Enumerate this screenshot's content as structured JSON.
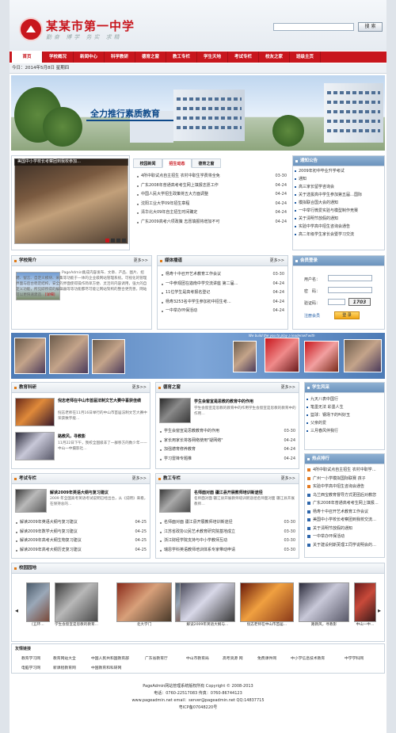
{
  "header": {
    "school_name": "某某市第一中学",
    "motto": "勤奋 博学 务实 求精",
    "search_placeholder": "",
    "search_label": "搜 索"
  },
  "nav": [
    "首页",
    "学校概况",
    "新闻中心",
    "科学教研",
    "德育之窗",
    "教工专栏",
    "学生天地",
    "考试专栏",
    "校友之家",
    "班级主页"
  ],
  "date_text": "今日：2014年5月8日 星期四",
  "banner": {
    "slogan": "全力推行素质教育"
  },
  "focus": {
    "caption": "美国中小学校长考察团到我校参加…"
  },
  "news_tabs": [
    "校园新闻",
    "招生动态",
    "德育之窗"
  ],
  "news": [
    {
      "title": "4所中职试点自主招生 农村中职生学费将全免",
      "date": "03-30"
    },
    {
      "title": "广东2008年普通高考考生网上填报志愿工作",
      "date": "04-24"
    },
    {
      "title": "中国人民大学招生政策将五大方面调整",
      "date": "04-24"
    },
    {
      "title": "沈阳工业大学09年招生章程",
      "date": "04-24"
    },
    {
      "title": "清华北大09年自主招生时间确定",
      "date": "04-24"
    },
    {
      "title": "广东2009高考六项政策 志愿填报将增加不可",
      "date": "04-24"
    }
  ],
  "notice": {
    "title": "通知公告",
    "items": [
      "2009年初中毕业升学考试",
      "通知",
      "高三家长留学咨询会",
      "关于选拔高中学生参加第五届…国际",
      "模拟联合国大会的通知",
      "一中举行微爱实验与模型制作竞赛",
      "关于清明节放假的通知",
      "实验中学高中招生咨询会通告",
      "高二年级学生家长会暨学习交流"
    ]
  },
  "intro": {
    "title": "学校简介",
    "more": "更多>>",
    "text": "PageAdmin集成内容发布、文章、产品、图片、招聘、留言、自定义模块、采集等功能于一体的企业级网站管理系统。可视化的管理界面与后台稳定结构，安全的界面使得操作简单方便、灵活的内容调用，强大的自定义功能，所见即所得的编辑器等等功能都尽可能让网站架构的整合更完善，网站可以更快速建造…",
    "detail": "[详细]"
  },
  "media": {
    "title": "媒体播道",
    "more": "更多>>",
    "items": [
      {
        "title": "杨寿十中召开艺术教育工作会议",
        "date": "03-30"
      },
      {
        "title": "一中参观团在迦南中学交流讲座 第二届…",
        "date": "04-24"
      },
      {
        "title": "11位学生是高考报名登记",
        "date": "04-24"
      },
      {
        "title": "杨寿3253名中学生参加初中招生考…",
        "date": "04-24"
      },
      {
        "title": "一中举办环保活动",
        "date": "04-24"
      }
    ]
  },
  "login": {
    "title": "会员登录",
    "username": "用户名：",
    "password": "密　码：",
    "captcha": "验证码：",
    "captcha_code": "1703",
    "register": "注册会员",
    "login_btn": "登 录"
  },
  "midstrip": {
    "tagline": "We build the you to play a leaderself with"
  },
  "research": {
    "title": "教育科研",
    "more": "更多>>",
    "feature1": {
      "title": "倪志老师在中山市首届法制文艺大赛中喜获佳绩",
      "text": "倪志老师在11月16日举行的中山市首届法制文艺大赛中荣获数字能…"
    },
    "feature2": {
      "title": "路教风，寻教影",
      "text": "11月22日下午，我校全国级非了一群移方的数少年——中山一中摄影社…"
    }
  },
  "moral": {
    "title": "德育之窗",
    "more": "更多>>",
    "feature": {
      "title": "学生会窗宣是思教的教育中的作用",
      "text": "学生会窗宣是思教的教育中的作用学生会窗宣是思教的教育中的作用…"
    },
    "items": [
      {
        "title": "学生会窗宣是思教教育中的作用",
        "date": "03-30"
      },
      {
        "title": "家长用家长将各网络使用\"疑网络\"",
        "date": "04-24"
      },
      {
        "title": "加强德育修养教育",
        "date": "04-24"
      },
      {
        "title": "学习雷锋专题推",
        "date": "04-24"
      }
    ]
  },
  "stu_style": {
    "title": "学生风采",
    "items": [
      "九天八表中国行",
      "笔墨无法 彩墨人生",
      "篮球：钢场下的叫好玉",
      "父亲的爱",
      "三月春风伴我行"
    ]
  },
  "exam": {
    "title": "考试专栏",
    "more": "更多>>",
    "feature": {
      "title": "解读2009年英语大纲与复习建议",
      "text": "2009 年全国高考英语考试说明已经出台，从《说明》来看，在保持总的…"
    },
    "items": [
      {
        "title": "解读2009年英语大纲与复习建议",
        "date": "04-25"
      },
      {
        "title": "解读2009年数学大纲与复习建议",
        "date": "04-25"
      },
      {
        "title": "解读2009年高考大纲生物复习建议",
        "date": "04-25"
      },
      {
        "title": "解读2009年高考大纲历史复习建议",
        "date": "04-25"
      }
    ]
  },
  "teacher": {
    "title": "教工专栏",
    "more": "更多>>",
    "feature": {
      "title": "名师面对面 疆江县开展教师培训新途径",
      "text": "名师面对面 疆江县开展教师培训新途径名师面对面 疆江县开展教师…"
    },
    "items": [
      {
        "title": "名师面对面 疆江县开展教师培训新途径",
        "date": "03-30"
      },
      {
        "title": "江苏省政协公民艺术教育研究院基地成立",
        "date": "03-30"
      },
      {
        "title": "浙江财经学院支持与中小学教师互动",
        "date": "03-30"
      },
      {
        "title": "瑞恩学科英语教师培训体系专家带动申请",
        "date": "03-30"
      }
    ]
  },
  "ranking": {
    "title": "热点排行",
    "items": [
      "4所中职试点自主招生 农村中职学…",
      "广州一小学模拟国际联赛 孩子",
      "实验中学高中招生咨询会通告",
      "乌兰西宝教育督导方式更团后对教您",
      "广东2008年普通高考考生网上填报…",
      "杨寿十中召开艺术教育工作会议",
      "美国中小学校长考察团到我校交流…",
      "关于清明节放假的通知",
      "一中举办环保活动",
      "关于建设利斯芙理工同学说明会的…"
    ]
  },
  "garden": {
    "title": "校园园地",
    "captions": [
      "[五环…",
      "学生会窗宣是思教的教育…",
      "北大学门",
      "",
      "解读2009年英语大纲与…",
      "倪志老师在中山市首届…",
      "路教风，寻教影",
      "中山一中…"
    ]
  },
  "links": {
    "title": "友情链接",
    "items": [
      "教育学习网",
      "教育网站大全",
      "中国人民共和国教育部",
      "广东省教育厅",
      "中山市教育局",
      "高考资源 网",
      "免费课件网",
      "中小学信息技术教育",
      "中学学科网",
      "电脑学习网",
      "新课程教育网",
      "中国教育和科研网"
    ]
  },
  "footer": {
    "line1": "PageAdmin网站管理系统版权所有  Copyright © 2008-2013",
    "line2": "电话：0760-22517083  传真：0760-86744123",
    "line3": "www.pageadmin.net  email：server@pageadmin.net  QQ:14837715",
    "line4": "粤ICP备07048220号"
  }
}
